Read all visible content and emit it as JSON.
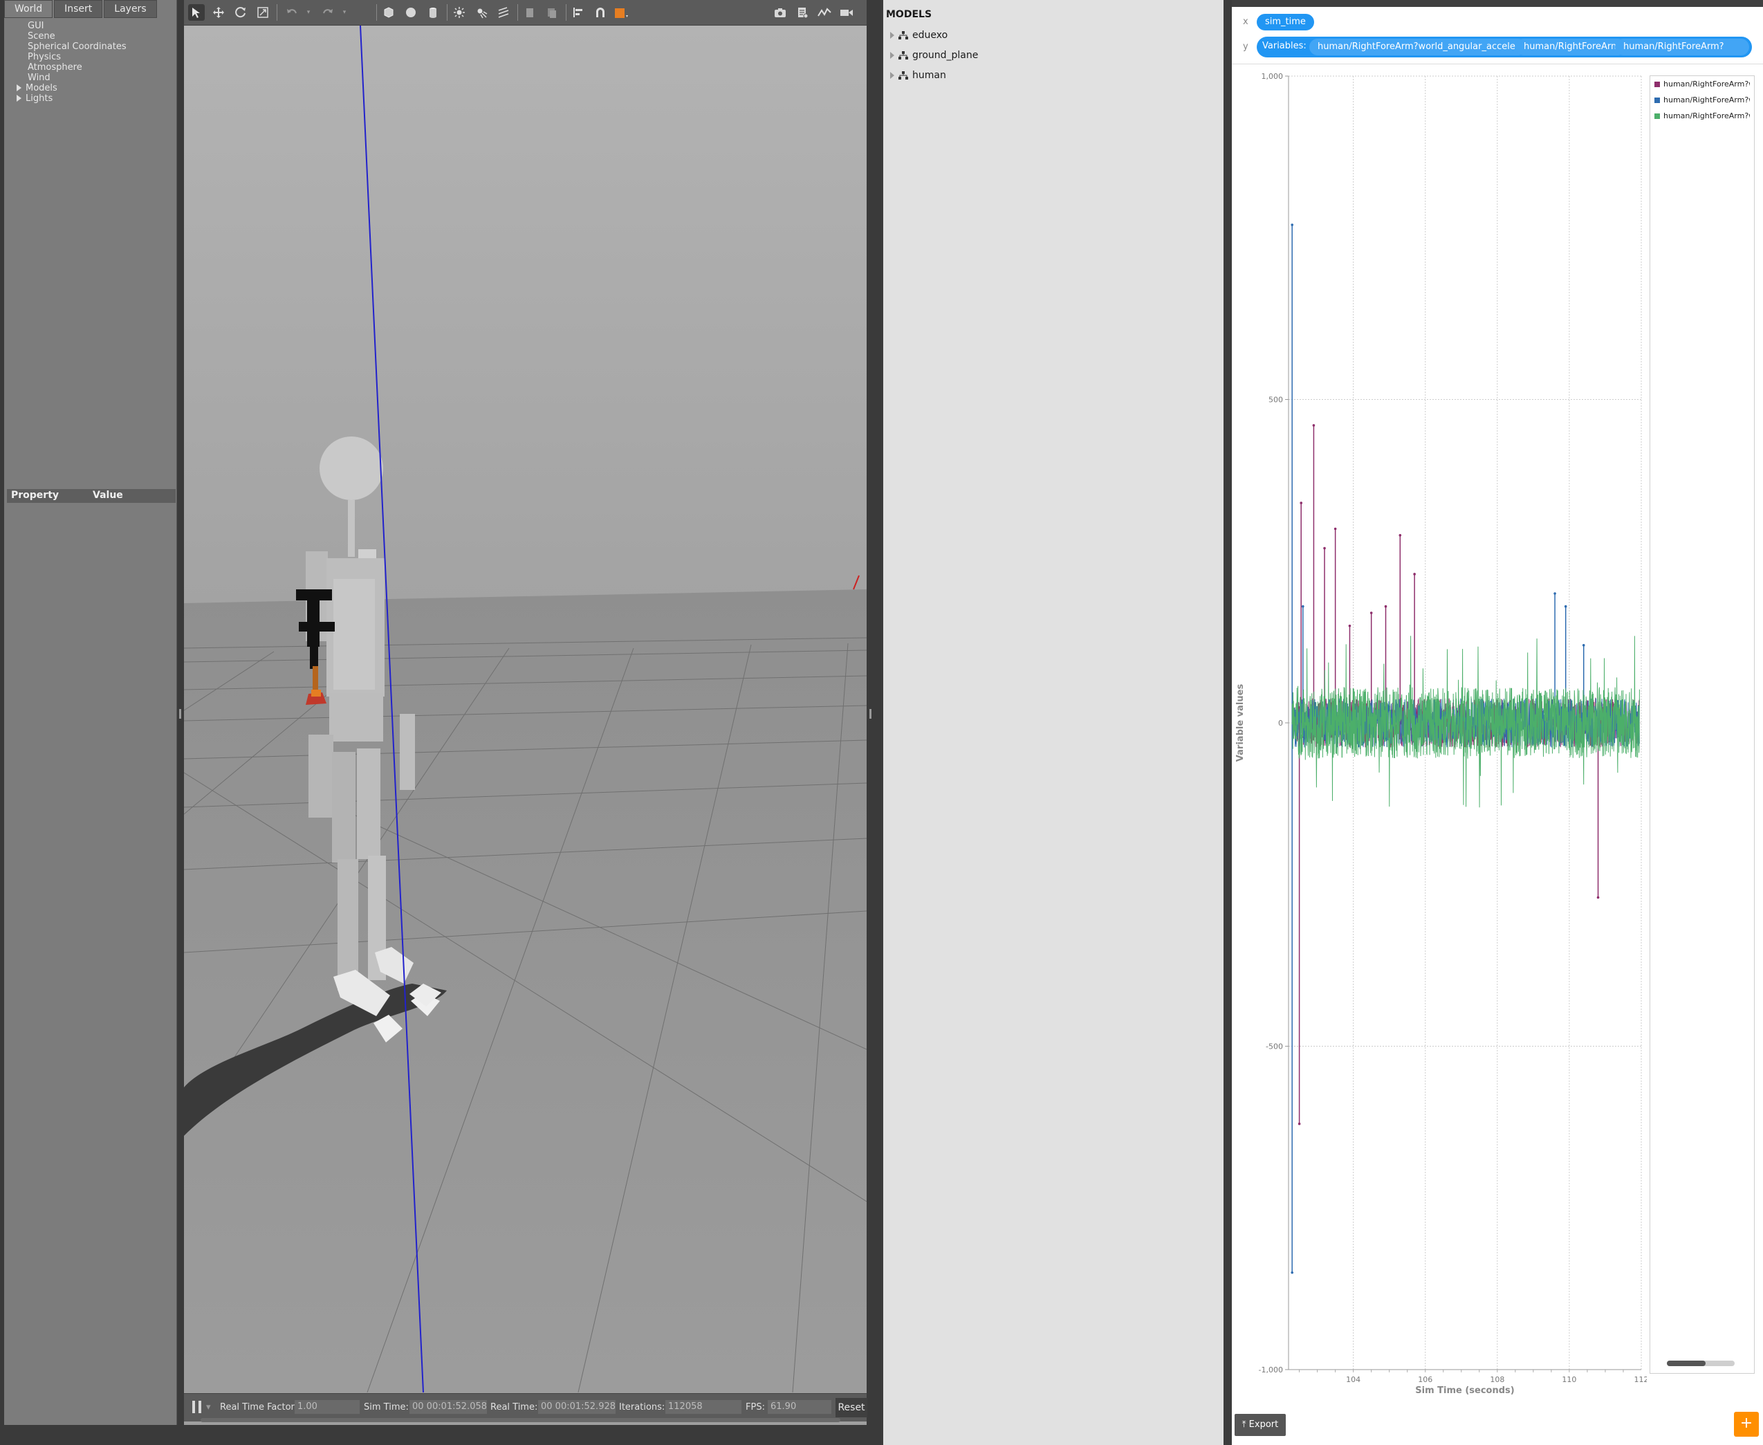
{
  "left_panel": {
    "tabs": [
      "World",
      "Insert",
      "Layers"
    ],
    "tree": [
      "GUI",
      "Scene",
      "Spherical Coordinates",
      "Physics",
      "Atmosphere",
      "Wind",
      "Models",
      "Lights"
    ],
    "property_header": "Property",
    "value_header": "Value"
  },
  "toolbar": {
    "icons": [
      "select-arrow-icon",
      "translate-icon",
      "rotate-icon",
      "scale-icon",
      "undo-icon",
      "undo-dropdown-icon",
      "redo-icon",
      "redo-dropdown-icon",
      "box-shape-icon",
      "sphere-shape-icon",
      "cylinder-shape-icon",
      "point-light-icon",
      "spot-light-icon",
      "directional-light-icon",
      "copy-icon",
      "paste-icon",
      "align-icon",
      "snap-icon",
      "view-angle-icon",
      "screenshot-icon",
      "log-icon",
      "plot-icon",
      "record-video-icon"
    ]
  },
  "bottom_bar": {
    "rtf_label": "Real Time Factor:",
    "rtf_value": "1.00",
    "sim_time_label": "Sim Time:",
    "sim_time_value": "00 00:01:52.058",
    "real_time_label": "Real Time:",
    "real_time_value": "00 00:01:52.928",
    "iterations_label": "Iterations:",
    "iterations_value": "112058",
    "fps_label": "FPS:",
    "fps_value": "61.90",
    "reset_label": "Reset"
  },
  "models_panel": {
    "title": "MODELS",
    "items": [
      "eduexo",
      "ground_plane",
      "human"
    ]
  },
  "plot": {
    "x_axis_letter": "x",
    "y_axis_letter": "y",
    "x_variable": "sim_time",
    "variables_label": "Variables:",
    "variables": [
      "human/RightForeArm?world_angular_acceleratio",
      "human/RightForeArm?",
      "human/RightForeArm?"
    ],
    "legend": [
      "human/RightForeArm?wo",
      "human/RightForeArm?wo",
      "human/RightForeArm?wo"
    ],
    "export_label": "Export",
    "add_label": "+",
    "colors": {
      "series1": "#8e2e6b",
      "series2": "#2e6cb0",
      "series3": "#4caf6a",
      "accent": "#2196f3",
      "add": "#ff8f00"
    }
  },
  "chart_data": {
    "type": "line",
    "title": "",
    "xlabel": "Sim Time (seconds)",
    "ylabel": "Variable values",
    "xlim": [
      102.2,
      112.0
    ],
    "ylim": [
      -1000,
      1000
    ],
    "x_ticks": [
      "104",
      "106",
      "108",
      "110",
      "112"
    ],
    "y_ticks": [
      "1,000",
      "500",
      "0",
      "-500",
      "-1,000"
    ],
    "grid": true,
    "legend_position": "right",
    "series": [
      {
        "name": "human/RightForeArm?wo",
        "color": "#8e2e6b",
        "spikes": [
          [
            102.55,
            340
          ],
          [
            102.5,
            -620
          ],
          [
            102.9,
            460
          ],
          [
            103.2,
            270
          ],
          [
            103.5,
            300
          ],
          [
            103.9,
            150
          ],
          [
            104.5,
            170
          ],
          [
            104.9,
            180
          ],
          [
            105.3,
            290
          ],
          [
            105.7,
            230
          ],
          [
            110.8,
            -270
          ]
        ]
      },
      {
        "name": "human/RightForeArm?wo",
        "color": "#2e6cb0",
        "spikes": [
          [
            102.3,
            770
          ],
          [
            102.3,
            -850
          ],
          [
            102.6,
            180
          ],
          [
            109.6,
            200
          ],
          [
            109.9,
            180
          ],
          [
            110.4,
            120
          ]
        ]
      },
      {
        "name": "human/RightForeArm?wo",
        "color": "#4caf6a",
        "noise_band": [
          -50,
          50
        ],
        "spike_range": [
          -150,
          140
        ]
      }
    ]
  }
}
